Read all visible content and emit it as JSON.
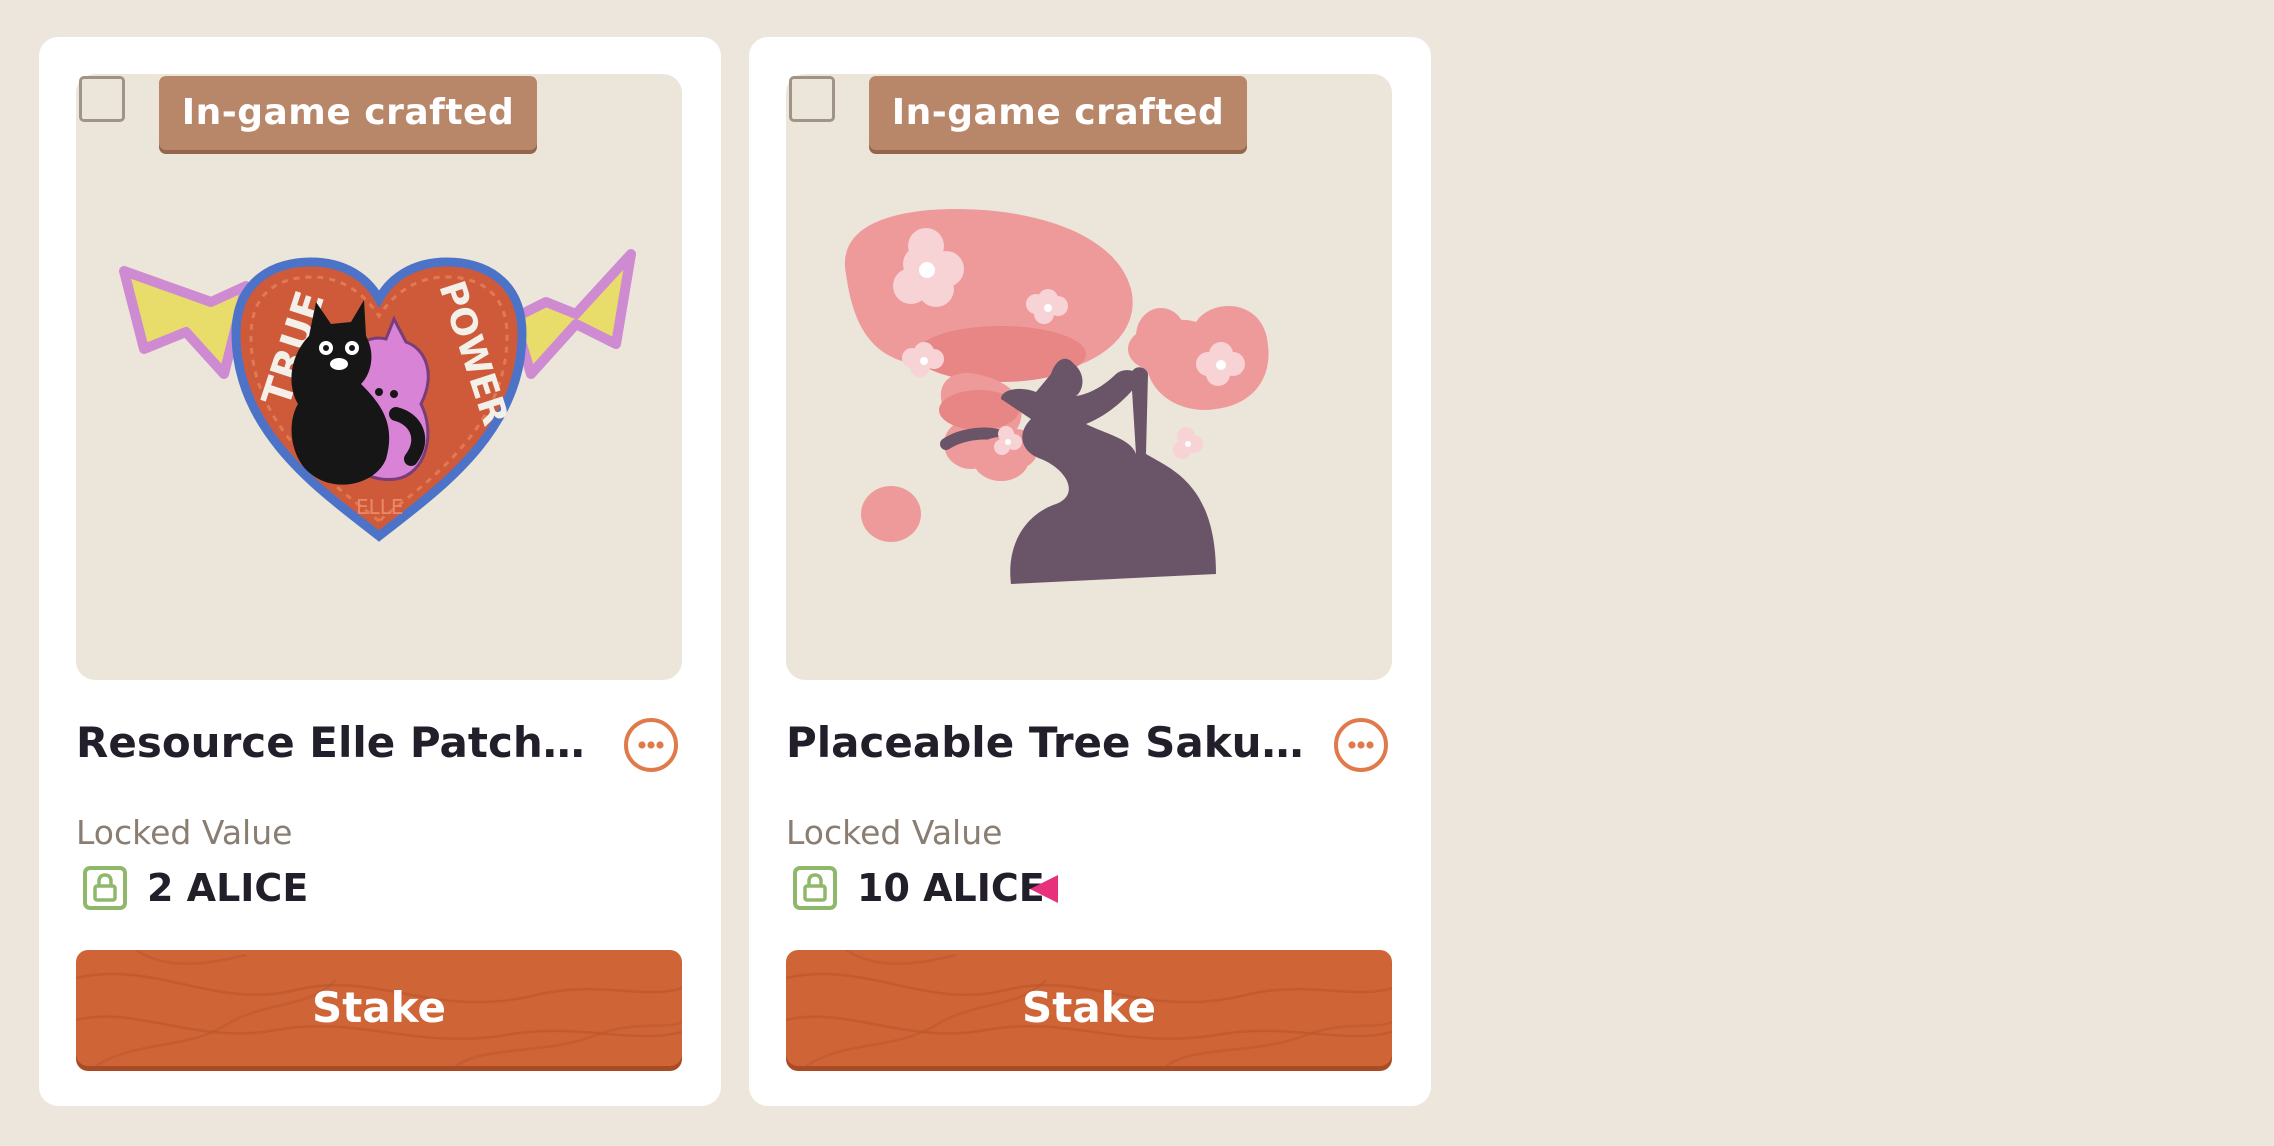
{
  "cards": [
    {
      "badge": "In-game crafted",
      "name": "Resource Elle Patch Ca...",
      "locked_label": "Locked Value",
      "locked_amount": "2 ALICE",
      "stake_label": "Stake",
      "artwork": "true-power-heart-patch",
      "artwork_text": {
        "left": "TRUE",
        "right": "POWER",
        "signature": "ELLE"
      }
    },
    {
      "badge": "In-game crafted",
      "name": "Placeable Tree Sakura",
      "locked_label": "Locked Value",
      "locked_amount": "10 ALICE",
      "stake_label": "Stake",
      "artwork": "sakura-tree"
    }
  ],
  "colors": {
    "page_background": "#ede6dc",
    "card_background": "#ffffff",
    "badge": "#b8876a",
    "stake_button": "#cf6436",
    "more_button": "#e07a4a",
    "lock_icon": "#8fb86b",
    "pointer_arrow": "#e8317a"
  },
  "annotation": {
    "pointer_arrow_target": "locked-amount-10-alice"
  }
}
